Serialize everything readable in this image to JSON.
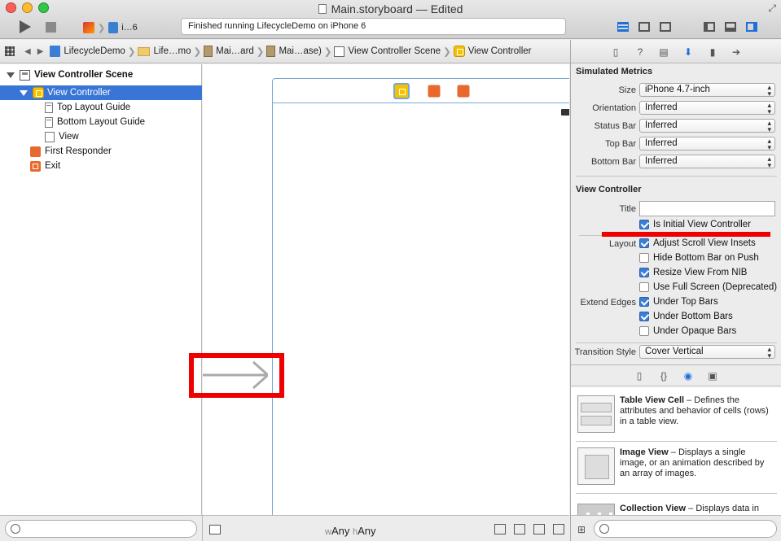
{
  "window": {
    "title": "Main.storyboard — Edited",
    "status": "Finished running LifecycleDemo on iPhone 6",
    "scheme_device": "i…6"
  },
  "jumpbar": {
    "crumbs": [
      "LifecycleDemo",
      "Life…mo",
      "Mai…ard",
      "Mai…ase)",
      "View Controller Scene",
      "View Controller"
    ]
  },
  "outline": {
    "scene": "View Controller Scene",
    "items": [
      {
        "label": "View Controller",
        "selected": true
      },
      {
        "label": "Top Layout Guide"
      },
      {
        "label": "Bottom Layout Guide"
      },
      {
        "label": "View"
      },
      {
        "label": "First Responder"
      },
      {
        "label": "Exit"
      }
    ]
  },
  "canvas": {
    "size_w": "Any",
    "size_h": "Any",
    "w_prefix": "w",
    "h_prefix": "h"
  },
  "inspector": {
    "simulated_metrics": {
      "title": "Simulated Metrics",
      "rows": [
        {
          "label": "Size",
          "value": "iPhone 4.7-inch"
        },
        {
          "label": "Orientation",
          "value": "Inferred"
        },
        {
          "label": "Status Bar",
          "value": "Inferred"
        },
        {
          "label": "Top Bar",
          "value": "Inferred"
        },
        {
          "label": "Bottom Bar",
          "value": "Inferred"
        }
      ]
    },
    "view_controller": {
      "title": "View Controller",
      "title_label": "Title",
      "title_value": "",
      "is_initial": "Is Initial View Controller",
      "layout_label": "Layout",
      "layout_options": [
        {
          "label": "Adjust Scroll View Insets",
          "checked": true
        },
        {
          "label": "Hide Bottom Bar on Push",
          "checked": false
        },
        {
          "label": "Resize View From NIB",
          "checked": true
        },
        {
          "label": "Use Full Screen (Deprecated)",
          "checked": false
        }
      ],
      "extend_edges_label": "Extend Edges",
      "extend_edges_options": [
        {
          "label": "Under Top Bars",
          "checked": true
        },
        {
          "label": "Under Bottom Bars",
          "checked": true
        },
        {
          "label": "Under Opaque Bars",
          "checked": false
        }
      ],
      "transition_label": "Transition Style",
      "transition_value": "Cover Vertical"
    }
  },
  "library": {
    "items": [
      {
        "name": "Table View Cell",
        "desc": " – Defines the attributes and behavior of cells (rows) in a table view."
      },
      {
        "name": "Image View",
        "desc": " – Displays a single image, or an animation described by an array of images."
      },
      {
        "name": "Collection View",
        "desc": " – Displays data in"
      }
    ]
  },
  "colors": {
    "selection": "#3875d7",
    "annotation_red": "#ee0000",
    "accent_blue": "#1e6fd9"
  }
}
